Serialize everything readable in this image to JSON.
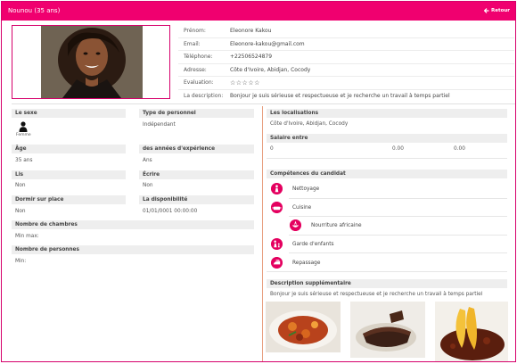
{
  "header": {
    "title": "Nounou (35 ans)",
    "back_label": "Retour"
  },
  "profile": {
    "fields": [
      {
        "key": "Prénom:",
        "value": "Eleonore Kakou"
      },
      {
        "key": "Email:",
        "value": "Eleonore-kakou@gmail.com"
      },
      {
        "key": "Téléphone:",
        "value": "+22506524879"
      },
      {
        "key": "Adresse:",
        "value": "Côte d'Ivoire, Abidjan, Cocody"
      },
      {
        "key": "Evaluation:",
        "value": "☆☆☆☆☆"
      },
      {
        "key": "La description:",
        "value": "Bonjour je suis sérieuse et respectueuse et je recherche un travail à temps partiel"
      }
    ]
  },
  "details": {
    "sexe_label": "Le sexe",
    "sexe_value": "Femme",
    "type_label": "Type de personnel",
    "type_value": "Indépendant",
    "age_label": "Âge",
    "age_value": "35 ans",
    "exp_label": "des années d'expérience",
    "exp_value": "Ans",
    "lis_label": "Lis",
    "lis_value": "Non",
    "ecrire_label": "Écrire",
    "ecrire_value": "Non",
    "dormir_label": "Dormir sur place",
    "dormir_value": "Non",
    "dispo_label": "La disponibilité",
    "dispo_value": "01/01/0001 00:00:00",
    "chambres_label": "Nombre de chambres",
    "chambres_value": "Min max:",
    "personnes_label": "Nombre de personnes",
    "personnes_value": "Min:"
  },
  "right": {
    "localisations_label": "Les localisations",
    "localisations_value": "Côte d'Ivoire, Abidjan, Cocody",
    "salaire_label": "Salaire entre",
    "salaire_values": [
      "0",
      "0.00",
      "0.00"
    ],
    "competences_label": "Compétences du candidat",
    "skills": [
      "Nettoyage",
      "Cuisine",
      "Nourriture africaine",
      "Garde d'enfants",
      "Repassage"
    ],
    "desc_label": "Description supplémentaire",
    "desc_value": "Bonjour je suis sérieuse et respectueuse et je recherche un travail à temps partiel"
  },
  "colors": {
    "accent": "#f0006f",
    "border": "#d6006b",
    "divider": "#e8a080"
  },
  "icons": [
    "back-arrow-icon",
    "person-icon",
    "cleaning-icon",
    "cooking-icon",
    "african-food-icon",
    "childcare-icon",
    "ironing-icon"
  ]
}
